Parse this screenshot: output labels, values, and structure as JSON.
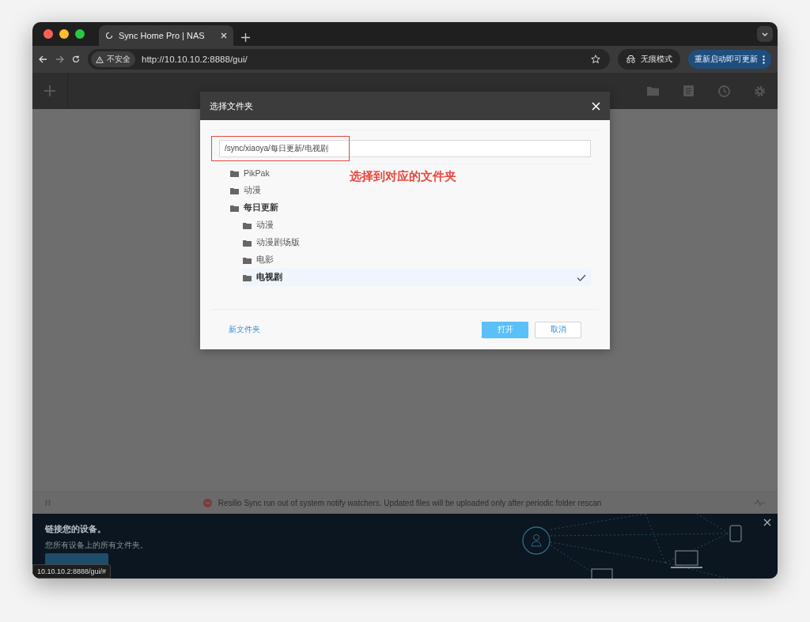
{
  "browser": {
    "tab_title": "Sync Home Pro | NAS",
    "security_label": "不安全",
    "url": "http://10.10.10.2:8888/gui/",
    "incognito_label": "无痕模式",
    "update_button": "重新启动即可更新"
  },
  "notification": "Resilio Sync run out of system notify watchers. Updated files will be uploaded only after periodic folder rescan",
  "dialog": {
    "title": "选择文件夹",
    "path": "/sync/xiaoya/每日更新/电视剧",
    "annotation": "选择到对应的文件夹",
    "folders": [
      {
        "name": "PikPak",
        "selected": false,
        "expanded": false
      },
      {
        "name": "动漫",
        "selected": false,
        "expanded": false
      },
      {
        "name": "每日更新",
        "selected": false,
        "expanded": true,
        "children": [
          {
            "name": "动漫",
            "selected": false,
            "expanded": false
          },
          {
            "name": "动漫剧场版",
            "selected": false,
            "expanded": false
          },
          {
            "name": "电影",
            "selected": false,
            "expanded": false
          },
          {
            "name": "电视剧",
            "selected": true,
            "expanded": false
          }
        ]
      }
    ],
    "new_folder_link": "新文件夹",
    "buttons": [
      {
        "label": "打开",
        "kind": "primary"
      },
      {
        "label": "取消",
        "kind": "secondary"
      }
    ]
  },
  "onboarding": {
    "title": "链接您的设备。",
    "subtitle": "您所有设备上的所有文件夹。"
  },
  "status_url": "10.10.10.2:8888/gui/#"
}
